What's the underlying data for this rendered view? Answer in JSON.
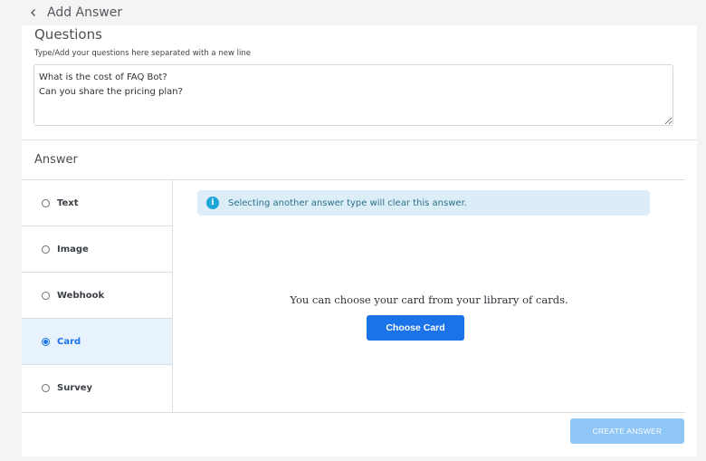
{
  "header": {
    "title": "Add Answer",
    "back_icon": "chevron-left-icon"
  },
  "questions": {
    "title": "Questions",
    "hint": "Type/Add your questions here separated with a new line",
    "value": "What is the cost of FAQ Bot?\nCan you share the pricing plan?"
  },
  "answer": {
    "title": "Answer",
    "types": [
      {
        "label": "Text",
        "selected": false
      },
      {
        "label": "Image",
        "selected": false
      },
      {
        "label": "Webhook",
        "selected": false
      },
      {
        "label": "Card",
        "selected": true
      },
      {
        "label": "Survey",
        "selected": false
      }
    ],
    "info": {
      "icon": "info-icon",
      "text": "Selecting another answer type will clear this answer."
    },
    "card_message": "You can choose your card from your library of cards.",
    "choose_card_label": "Choose Card"
  },
  "footer": {
    "create_answer_label": "CREATE ANSWER",
    "create_answer_enabled": false
  },
  "colors": {
    "accent": "#1a73e8",
    "selected_bg": "#e8f2fd",
    "info_bg": "#dbeef7",
    "disabled_button": "#8ec6f5"
  }
}
